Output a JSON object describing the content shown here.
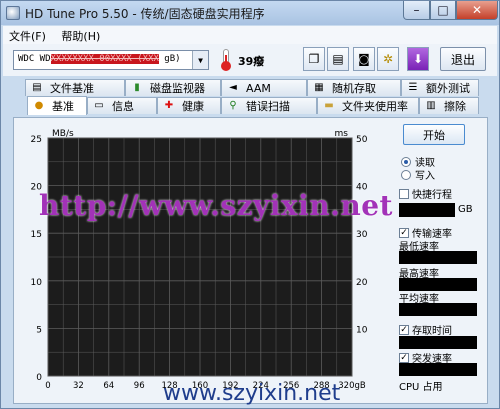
{
  "window": {
    "title": "HD Tune Pro 5.50 - 传统/固态硬盘实用程序"
  },
  "menu": {
    "file": "文件(F)",
    "help": "帮助(H)"
  },
  "toolbar": {
    "drive_prefix": "WDC WD",
    "drive_redacted": "XXXXXXXX-00XXXX (XXX",
    "drive_suffix": " gB)",
    "temperature": "39癈",
    "exit_label": "退出"
  },
  "tabs_top": [
    "文件基准",
    "磁盘监视器",
    "AAM",
    "随机存取",
    "额外测试"
  ],
  "tabs_bottom": [
    "基准",
    "信息",
    "健康",
    "错误扫描",
    "文件夹使用率",
    "擦除"
  ],
  "controls": {
    "start_label": "开始",
    "read_label": "读取",
    "write_label": "写入",
    "read_selected": true,
    "quick_label": "快捷行程",
    "gb_label": "GB",
    "transfer_label": "传输速率",
    "min_label": "最低速率",
    "max_label": "最高速率",
    "avg_label": "平均速率",
    "access_label": "存取时间",
    "burst_label": "突发速率",
    "cpu_label": "CPU 占用"
  },
  "chart_data": {
    "type": "line",
    "ylabel_left": "MB/s",
    "ylabel_right": "ms",
    "y_left_ticks": [
      "25",
      "20",
      "15",
      "10",
      "5",
      "0"
    ],
    "y_right_ticks": [
      "50",
      "40",
      "30",
      "20",
      "10"
    ],
    "x_ticks": [
      "0",
      "32",
      "64",
      "96",
      "128",
      "160",
      "192",
      "224",
      "256",
      "288",
      "320gB"
    ],
    "series": [],
    "grid": true
  },
  "watermark": {
    "main": "http://www.szyixin.net",
    "bottom": "www.szyixin.net"
  },
  "colors": {
    "chart_bg": "#1c1c1c",
    "grid": "#5c5c5c",
    "watermark": "#a232b8"
  }
}
